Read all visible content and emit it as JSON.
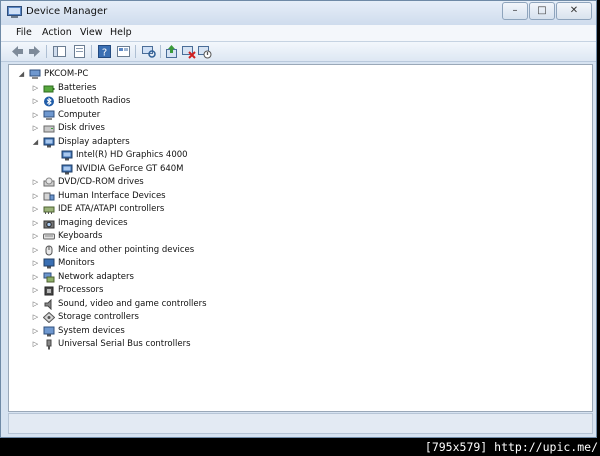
{
  "window": {
    "title": "Device Manager"
  },
  "menu": [
    "File",
    "Action",
    "View",
    "Help"
  ],
  "tree": {
    "root": "PKCOM-PC",
    "items": [
      {
        "label": "Batteries",
        "expanded": false,
        "icon": "battery-icon"
      },
      {
        "label": "Bluetooth Radios",
        "expanded": false,
        "icon": "bluetooth-icon"
      },
      {
        "label": "Computer",
        "expanded": false,
        "icon": "computer-icon"
      },
      {
        "label": "Disk drives",
        "expanded": false,
        "icon": "disk-drive-icon"
      },
      {
        "label": "Display adapters",
        "expanded": true,
        "icon": "display-adapter-icon",
        "children": [
          {
            "label": "Intel(R) HD Graphics 4000",
            "icon": "display-adapter-icon"
          },
          {
            "label": "NVIDIA GeForce GT 640M",
            "icon": "display-adapter-icon"
          }
        ]
      },
      {
        "label": "DVD/CD-ROM drives",
        "expanded": false,
        "icon": "dvd-drive-icon"
      },
      {
        "label": "Human Interface Devices",
        "expanded": false,
        "icon": "hid-icon"
      },
      {
        "label": "IDE ATA/ATAPI controllers",
        "expanded": false,
        "icon": "ide-controller-icon"
      },
      {
        "label": "Imaging devices",
        "expanded": false,
        "icon": "camera-icon"
      },
      {
        "label": "Keyboards",
        "expanded": false,
        "icon": "keyboard-icon"
      },
      {
        "label": "Mice and other pointing devices",
        "expanded": false,
        "icon": "mouse-icon"
      },
      {
        "label": "Monitors",
        "expanded": false,
        "icon": "monitor-icon"
      },
      {
        "label": "Network adapters",
        "expanded": false,
        "icon": "network-adapter-icon"
      },
      {
        "label": "Processors",
        "expanded": false,
        "icon": "processor-icon"
      },
      {
        "label": "Sound, video and game controllers",
        "expanded": false,
        "icon": "speaker-icon"
      },
      {
        "label": "Storage controllers",
        "expanded": false,
        "icon": "storage-controller-icon"
      },
      {
        "label": "System devices",
        "expanded": false,
        "icon": "system-device-icon"
      },
      {
        "label": "Universal Serial Bus controllers",
        "expanded": false,
        "icon": "usb-icon"
      }
    ]
  },
  "watermark": "[795x579] http://upic.me/",
  "colors": {
    "titlebar": "#dce7f4",
    "accent": "#3a6fb3"
  }
}
